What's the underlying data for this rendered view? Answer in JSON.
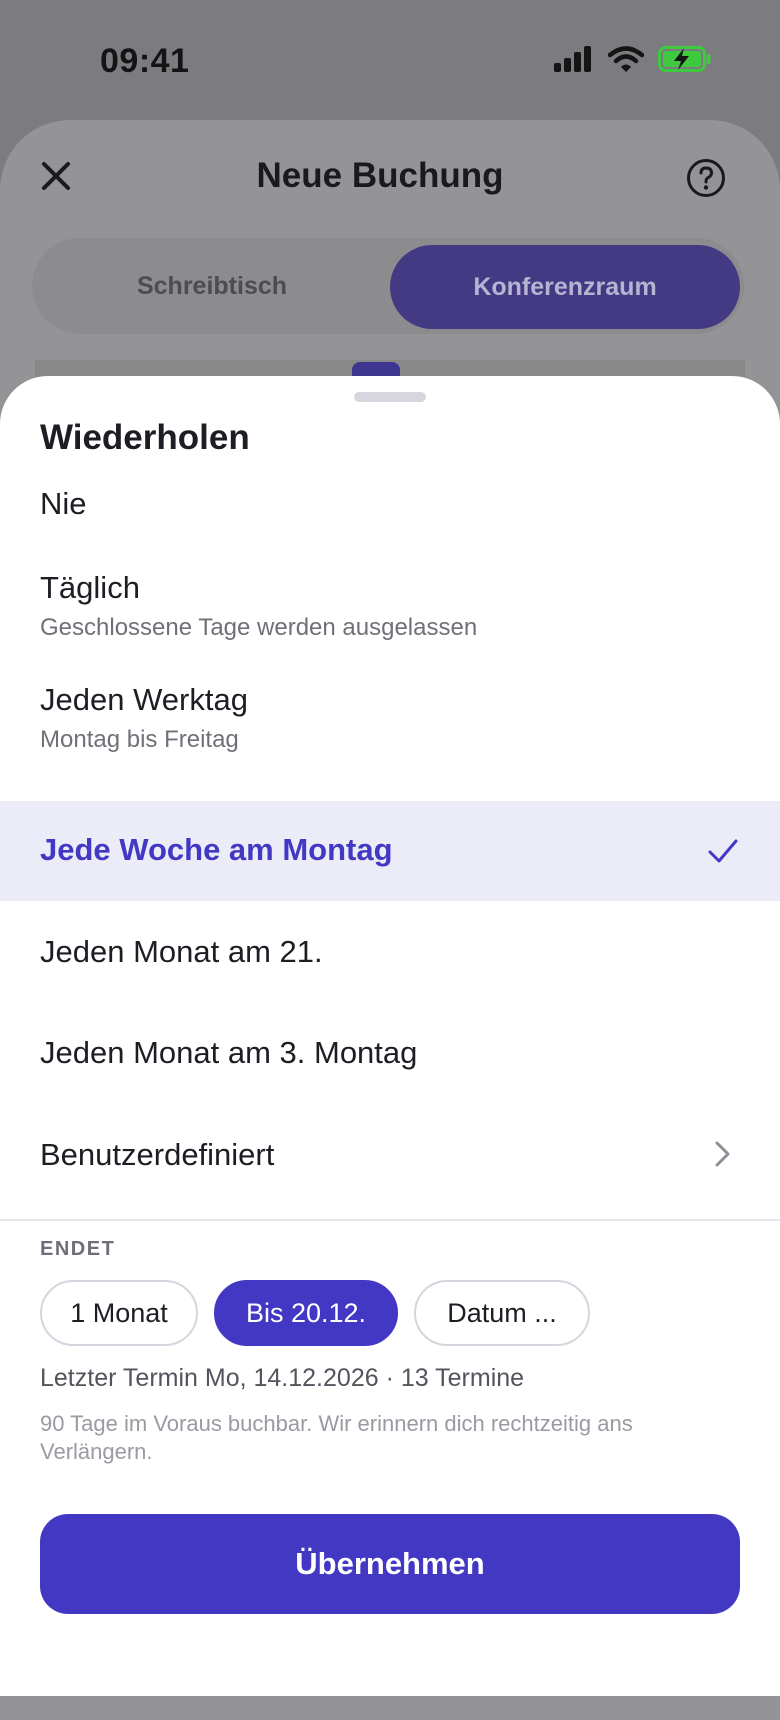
{
  "status_bar": {
    "time": "09:41",
    "battery_color": "#3ec93e"
  },
  "background": {
    "title": "Neue Buchung",
    "tabs": [
      {
        "label": "Schreibtisch",
        "selected": false
      },
      {
        "label": "Konferenzraum",
        "selected": true
      }
    ]
  },
  "sheet": {
    "title": "Wiederholen",
    "options": [
      {
        "label": "Nie",
        "sub": ""
      },
      {
        "label": "Täglich",
        "sub": "Geschlossene Tage werden ausgelassen"
      },
      {
        "label": "Jeden Werktag",
        "sub": "Montag bis Freitag"
      },
      {
        "label": "Jede Woche am Montag",
        "sub": "",
        "selected": true
      },
      {
        "label": "Jeden Monat am 21.",
        "sub": ""
      },
      {
        "label": "Jeden Monat am 3. Montag",
        "sub": ""
      },
      {
        "label": "Benutzerdefiniert",
        "sub": ""
      }
    ],
    "ends_label": "ENDET",
    "end_chips": [
      {
        "label": "1 Monat",
        "selected": false
      },
      {
        "label": "Bis 20.12.",
        "selected": true
      },
      {
        "label": "Datum ...",
        "selected": false
      }
    ],
    "summary": "Letzter Termin Mo, 14.12.2026 · 13 Termine",
    "note": "90 Tage im Voraus buchbar. Wir erinnern dich rechtzeitig ans Verlängern.",
    "apply_label": "Übernehmen",
    "accent_color": "#4338c4"
  }
}
